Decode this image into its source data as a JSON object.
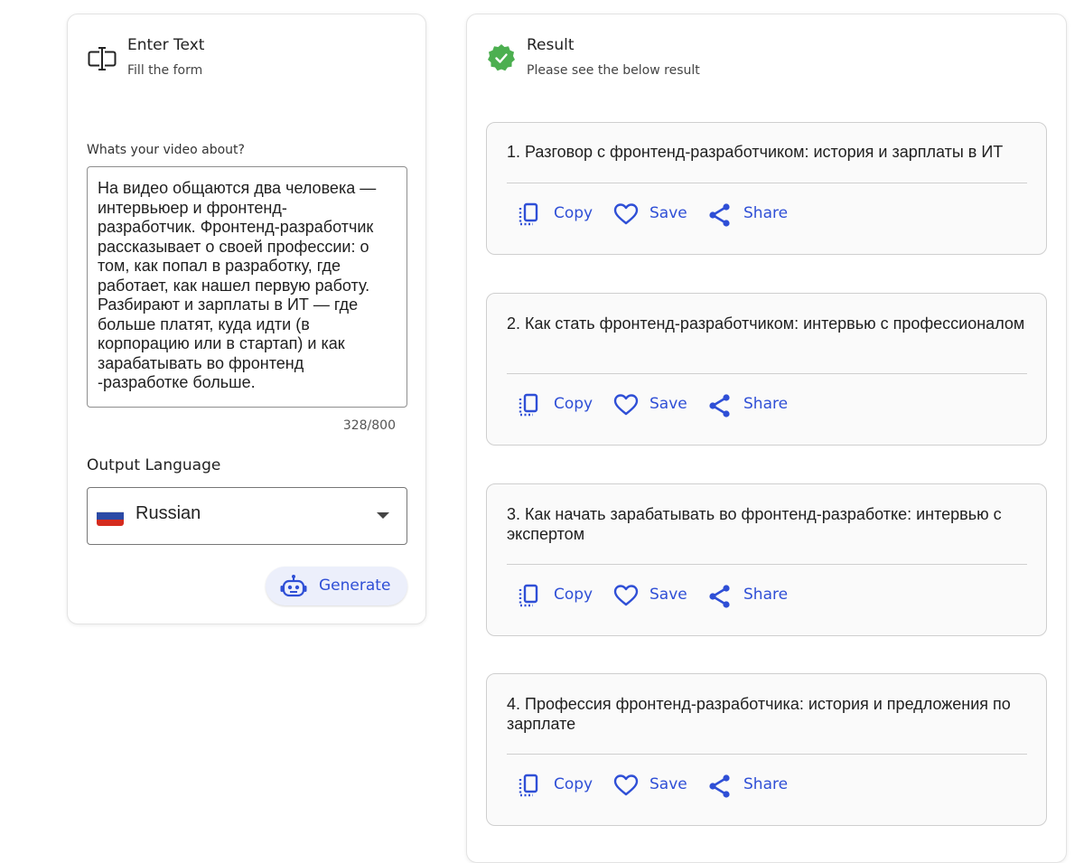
{
  "input_panel": {
    "title": "Enter Text",
    "subtitle": "Fill the form",
    "icon": "text-cursor-icon",
    "video_label": "Whats your video about?",
    "video_text": "На видео общаются два человека —\nинтервьюер и фронтенд-\nразработчик. Фронтенд-разработчик\nрассказывает о своей профессии: о\nтом, как попал в разработку, где\nработает, как нашел первую работу.\nРазбирают и зарплаты в ИТ — где\nбольше платят, куда идти (в\nкорпорацию или в стартап) и как\nзарабатывать во фронтенд\n-разработке больше.",
    "char_count": "328/800",
    "language_label": "Output Language",
    "language_value": "Russian",
    "language_flag": "ru-flag-icon",
    "generate_label": "Generate"
  },
  "result_panel": {
    "title": "Result",
    "subtitle": "Please see the below result",
    "icon": "check-badge-icon",
    "accent": "#4caf50",
    "results": [
      {
        "text": "1. Разговор с фронтенд-разработчиком: история и зарплаты в ИТ"
      },
      {
        "text": "2. Как стать фронтенд-разработчиком: интервью с профессионалом"
      },
      {
        "text": "3. Как начать зарабатывать во фронтенд-разработке: интервью с экспертом"
      },
      {
        "text": "4. Профессия фронтенд-разработчика: история и предложения по зарплате"
      }
    ],
    "actions": {
      "copy": "Copy",
      "save": "Save",
      "share": "Share"
    }
  },
  "colors": {
    "link": "#2f4fd6",
    "button_bg": "#eceffb"
  }
}
